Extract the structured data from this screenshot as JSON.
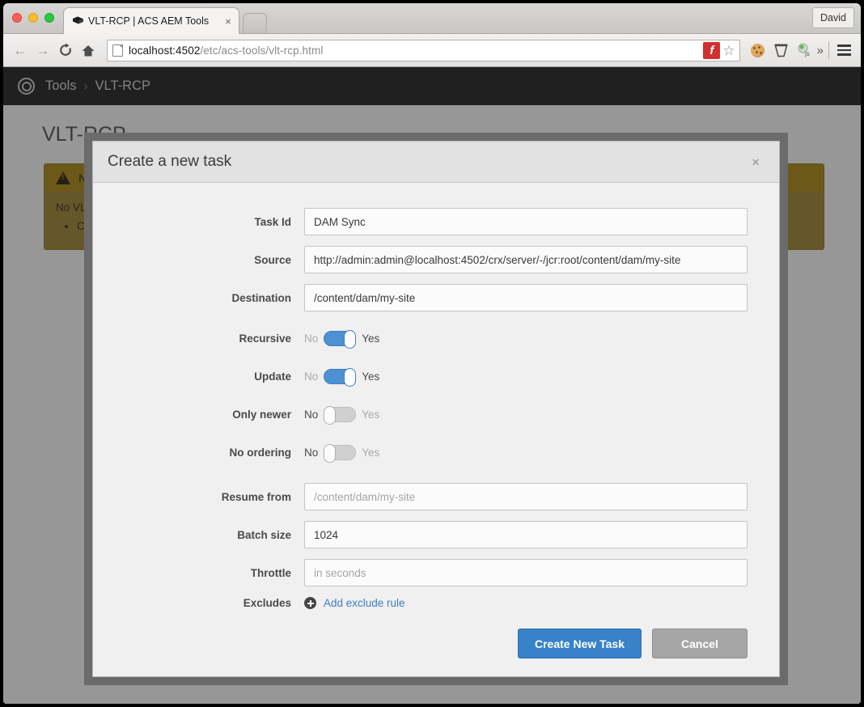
{
  "browser": {
    "tab": {
      "title": "VLT-RCP | ACS AEM Tools",
      "close_label": "×",
      "favicon": "vlt-favicon"
    },
    "profile_label": "David",
    "nav": {
      "back": "←",
      "forward": "→",
      "reload": "⟳",
      "home": "⌂"
    },
    "url": {
      "host": "localhost:4502",
      "path": "/etc/acs-tools/vlt-rcp.html"
    },
    "omnibox_icons": {
      "flash": "f",
      "bookmark_star": "☆"
    },
    "toolbar_icons": {
      "cookie": "cookie-icon",
      "bin": "bin-icon",
      "js": "js-icon",
      "more": "»",
      "menu": "hamburger-icon"
    }
  },
  "aem": {
    "logo": "adobe-experience-manager-logo",
    "breadcrumb": {
      "root": "Tools",
      "separator": "›",
      "current": "VLT-RCP"
    },
    "page_title": "VLT-RCP",
    "alert": {
      "heading": "No tasks found",
      "body": "No VLT-RCP tasks have been created yet.",
      "bullets": [
        "Create a new task to get started."
      ]
    }
  },
  "modal": {
    "title": "Create a new task",
    "close_label": "×",
    "fields": {
      "task_id": {
        "label": "Task Id",
        "value": "DAM Sync",
        "placeholder": ""
      },
      "source": {
        "label": "Source",
        "value": "http://admin:admin@localhost:4502/crx/server/-/jcr:root/content/dam/my-site",
        "placeholder": ""
      },
      "destination": {
        "label": "Destination",
        "value": "/content/dam/my-site",
        "placeholder": ""
      },
      "resume_from": {
        "label": "Resume from",
        "value": "",
        "placeholder": "/content/dam/my-site"
      },
      "batch_size": {
        "label": "Batch size",
        "value": "1024",
        "placeholder": ""
      },
      "throttle": {
        "label": "Throttle",
        "value": "",
        "placeholder": "in seconds"
      }
    },
    "switches": {
      "off_label": "No",
      "on_label": "Yes",
      "recursive": {
        "label": "Recursive",
        "state": "Yes"
      },
      "update": {
        "label": "Update",
        "state": "Yes"
      },
      "only_newer": {
        "label": "Only newer",
        "state": "No"
      },
      "no_ordering": {
        "label": "No ordering",
        "state": "No"
      }
    },
    "excludes": {
      "label": "Excludes",
      "add_link": "Add exclude rule",
      "icon": "plus-circle-icon"
    },
    "buttons": {
      "primary": "Create New Task",
      "secondary": "Cancel"
    }
  },
  "colors": {
    "accent_blue": "#3782c8",
    "switch_on": "#4d91d4",
    "link_blue": "#3c7ebf",
    "alert_bg": "#9a7f2e",
    "alert_head_bg": "#a4820f",
    "header_dark": "#1a1a1a"
  }
}
